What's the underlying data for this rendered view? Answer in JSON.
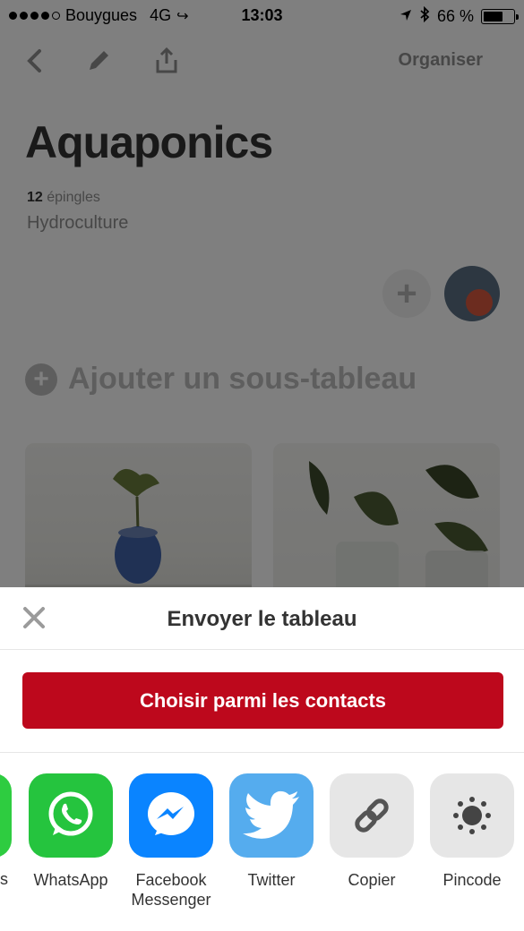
{
  "status_bar": {
    "carrier": "Bouygues",
    "network": "4G",
    "time": "13:03",
    "battery_percent": "66 %",
    "battery_level": 0.66
  },
  "board": {
    "organize_label": "Organiser",
    "title": "Aquaponics",
    "pin_count": "12",
    "pin_count_suffix": "épingles",
    "description": "Hydroculture",
    "add_subboard_label": "Ajouter un sous-tableau"
  },
  "sheet": {
    "title": "Envoyer le tableau",
    "contacts_button": "Choisir parmi les contacts",
    "partial_label": "s",
    "apps": [
      {
        "label": "WhatsApp",
        "icon": "whatsapp-icon",
        "color": "#25c43e"
      },
      {
        "label": "Facebook Messenger",
        "icon": "messenger-icon",
        "color": "#0a84ff"
      },
      {
        "label": "Twitter",
        "icon": "twitter-icon",
        "color": "#55acee"
      },
      {
        "label": "Copier",
        "icon": "link-icon",
        "color": "#e6e6e6"
      },
      {
        "label": "Pincode",
        "icon": "pincode-icon",
        "color": "#e6e6e6"
      }
    ]
  },
  "colors": {
    "brand_red": "#bd081c",
    "overlay": "rgba(0,0,0,0.5)"
  }
}
